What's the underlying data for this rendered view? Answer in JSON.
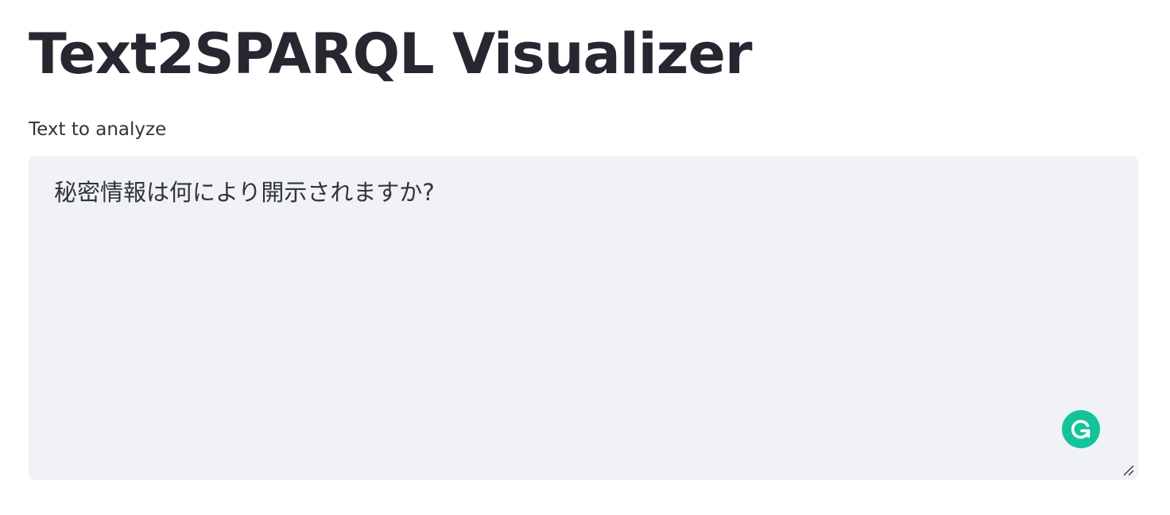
{
  "header": {
    "title": "Text2SPARQL Visualizer"
  },
  "form": {
    "label": "Text to analyze",
    "textarea_value": "秘密情報は何により開示されますか?"
  },
  "icons": {
    "grammarly": "grammarly-g-icon",
    "resize": "resize-grip-icon"
  },
  "colors": {
    "textarea_background": "#f0f2f6",
    "title_text": "#262730",
    "grammarly_green": "#15c39a"
  }
}
